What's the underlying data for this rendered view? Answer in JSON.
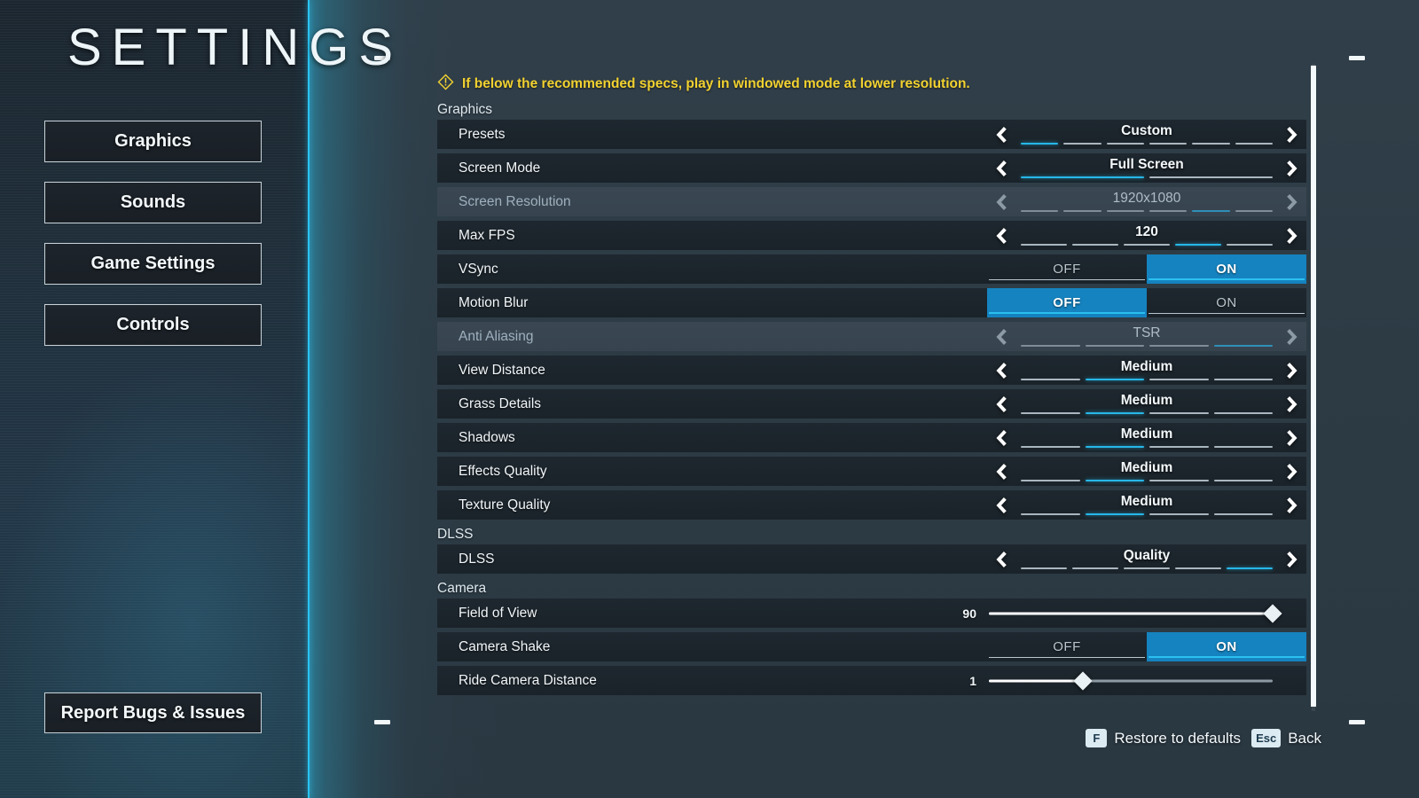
{
  "colors": {
    "accent_cyan": "#29c3f2",
    "toggle_active_blue": "#1583bf",
    "warning_yellow": "#f2d230",
    "row_bg": "#1e272f",
    "row_bg_disabled": "#3a4753",
    "text_primary": "#f1f6f9",
    "text_disabled": "#9fb0bd",
    "keycap_bg": "#dceaf2"
  },
  "header": {
    "title": "SETTINGS"
  },
  "sidebar": {
    "items": [
      {
        "label": "Graphics",
        "active": true
      },
      {
        "label": "Sounds",
        "active": false
      },
      {
        "label": "Game Settings",
        "active": false
      },
      {
        "label": "Controls",
        "active": false
      }
    ],
    "report_button": {
      "label": "Report Bugs & Issues"
    }
  },
  "warning": {
    "icon": "warning-diamond-icon",
    "text": "If below the recommended specs, play in windowed mode at lower resolution."
  },
  "sections": [
    {
      "name": "Graphics",
      "rows": [
        {
          "label": "Presets",
          "control": "selector",
          "value": "Custom",
          "segments": 6,
          "active_segment": 1,
          "disabled": false
        },
        {
          "label": "Screen Mode",
          "control": "selector",
          "value": "Full Screen",
          "segments": 2,
          "active_segment": 1,
          "disabled": false
        },
        {
          "label": "Screen Resolution",
          "control": "selector",
          "value": "1920x1080",
          "segments": 6,
          "active_segment": 5,
          "disabled": true
        },
        {
          "label": "Max FPS",
          "control": "selector",
          "value": "120",
          "segments": 5,
          "active_segment": 4,
          "disabled": false
        },
        {
          "label": "VSync",
          "control": "toggle",
          "options": [
            "OFF",
            "ON"
          ],
          "value": "ON",
          "disabled": false
        },
        {
          "label": "Motion Blur",
          "control": "toggle",
          "options": [
            "OFF",
            "ON"
          ],
          "value": "OFF",
          "disabled": false
        },
        {
          "label": "Anti Aliasing",
          "control": "selector",
          "value": "TSR",
          "segments": 4,
          "active_segment": 4,
          "disabled": true
        },
        {
          "label": "View Distance",
          "control": "selector",
          "value": "Medium",
          "segments": 4,
          "active_segment": 2,
          "disabled": false
        },
        {
          "label": "Grass Details",
          "control": "selector",
          "value": "Medium",
          "segments": 4,
          "active_segment": 2,
          "disabled": false
        },
        {
          "label": "Shadows",
          "control": "selector",
          "value": "Medium",
          "segments": 4,
          "active_segment": 2,
          "disabled": false
        },
        {
          "label": "Effects Quality",
          "control": "selector",
          "value": "Medium",
          "segments": 4,
          "active_segment": 2,
          "disabled": false
        },
        {
          "label": "Texture Quality",
          "control": "selector",
          "value": "Medium",
          "segments": 4,
          "active_segment": 2,
          "disabled": false
        }
      ]
    },
    {
      "name": "DLSS",
      "rows": [
        {
          "label": "DLSS",
          "control": "selector",
          "value": "Quality",
          "segments": 5,
          "active_segment": 5,
          "disabled": false
        }
      ]
    },
    {
      "name": "Camera",
      "rows": [
        {
          "label": "Field of View",
          "control": "slider",
          "value": "90",
          "fill_percent": 100,
          "disabled": false
        },
        {
          "label": "Camera Shake",
          "control": "toggle",
          "options": [
            "OFF",
            "ON"
          ],
          "value": "ON",
          "disabled": false
        },
        {
          "label": "Ride Camera Distance",
          "control": "slider",
          "value": "1",
          "fill_percent": 33,
          "disabled": false
        }
      ]
    }
  ],
  "footer": {
    "hints": [
      {
        "key": "F",
        "label": "Restore to defaults"
      },
      {
        "key": "Esc",
        "label": "Back"
      }
    ]
  }
}
